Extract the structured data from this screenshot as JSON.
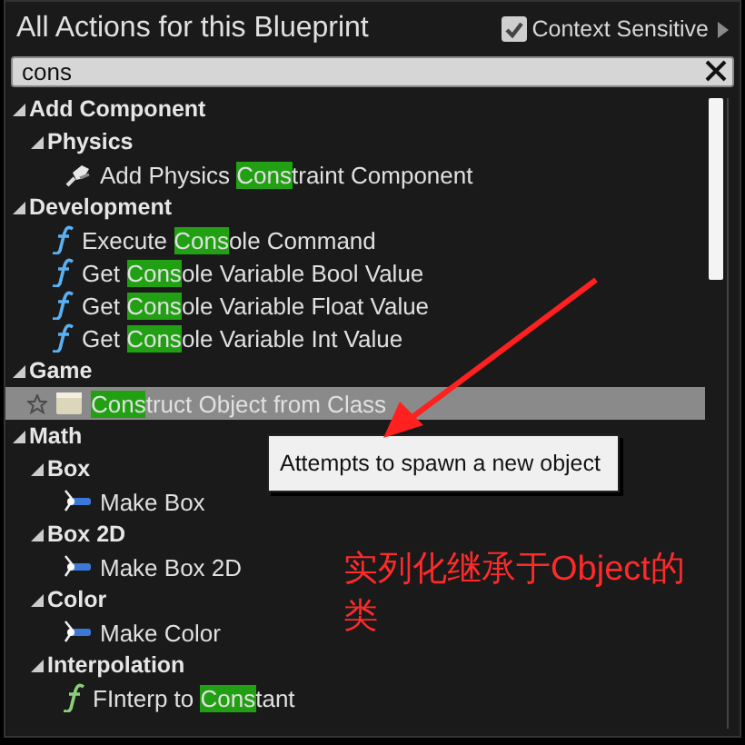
{
  "header": {
    "title": "All Actions for this Blueprint",
    "context_sensitive": {
      "label": "Context Sensitive",
      "checked": true
    }
  },
  "search": {
    "value": "cons"
  },
  "tree": [
    {
      "label": "Add Component",
      "expanded": true,
      "children": [
        {
          "label": "Physics",
          "expanded": true,
          "children": [
            {
              "kind": "component",
              "pre": "Add Physics ",
              "match": "Cons",
              "post": "traint Component",
              "selected": false
            }
          ]
        }
      ]
    },
    {
      "label": "Development",
      "expanded": true,
      "children": [
        {
          "kind": "function",
          "pre": "Execute ",
          "match": "Cons",
          "post": "ole Command",
          "selected": false
        },
        {
          "kind": "function",
          "pre": "Get ",
          "match": "Cons",
          "post": "ole Variable Bool Value",
          "selected": false
        },
        {
          "kind": "function",
          "pre": "Get ",
          "match": "Cons",
          "post": "ole Variable Float Value",
          "selected": false
        },
        {
          "kind": "function",
          "pre": "Get ",
          "match": "Cons",
          "post": "ole Variable Int Value",
          "selected": false
        }
      ]
    },
    {
      "label": "Game",
      "expanded": true,
      "children": [
        {
          "kind": "object",
          "favorite": false,
          "match": "Cons",
          "post": "truct Object from Class",
          "selected": true
        }
      ]
    },
    {
      "label": "Math",
      "expanded": true,
      "children": [
        {
          "label": "Box",
          "expanded": true,
          "children": [
            {
              "kind": "struct",
              "pre": "Make Box",
              "selected": false
            }
          ]
        },
        {
          "label": "Box 2D",
          "expanded": true,
          "children": [
            {
              "kind": "struct",
              "pre": "Make Box 2D",
              "selected": false
            }
          ]
        },
        {
          "label": "Color",
          "expanded": true,
          "children": [
            {
              "kind": "struct",
              "pre": "Make Color",
              "selected": false
            }
          ]
        },
        {
          "label": "Interpolation",
          "expanded": true,
          "children": [
            {
              "kind": "pure-function",
              "pre": "FInterp to ",
              "match": "Cons",
              "post": "tant",
              "selected": false
            }
          ]
        }
      ]
    }
  ],
  "tooltip": {
    "text": "Attempts to spawn a new object"
  },
  "annotation": {
    "text": "实列化继承于Object的类"
  }
}
